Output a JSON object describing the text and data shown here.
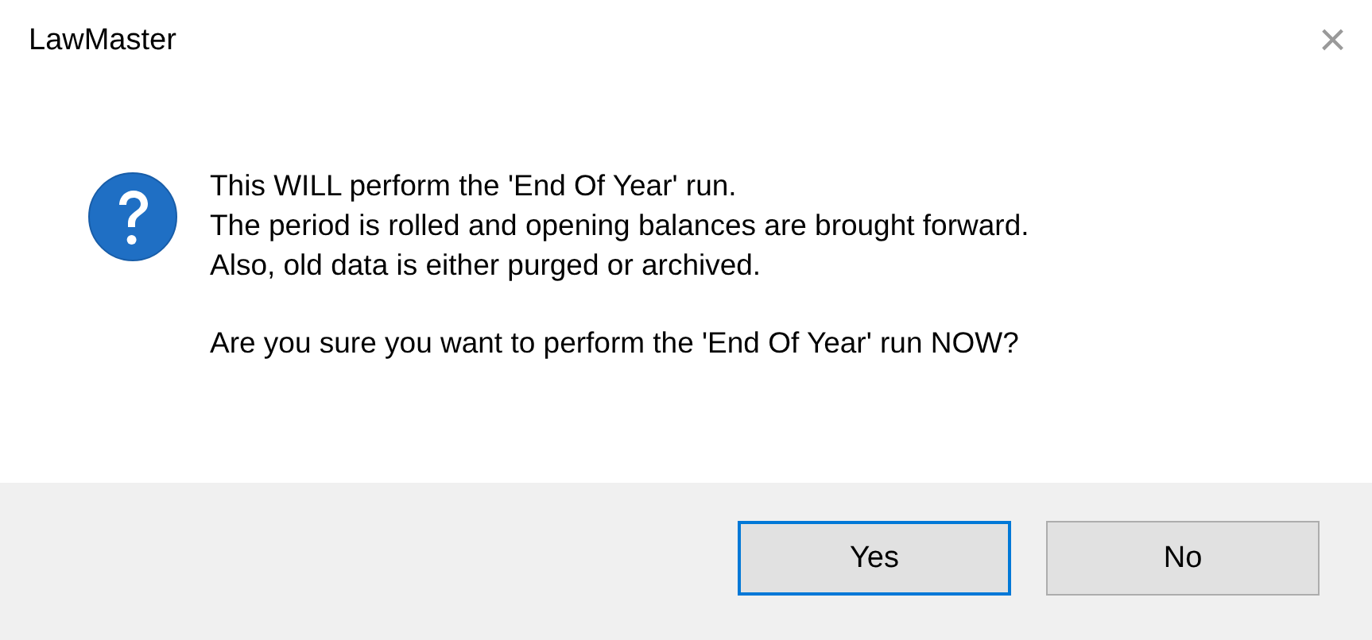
{
  "window": {
    "title": "LawMaster",
    "close": "×"
  },
  "message": {
    "lines": [
      "This WILL perform the 'End Of Year' run.",
      "The period is rolled and opening balances are brought forward.",
      "Also, old data is either purged or archived."
    ],
    "question": "Are you sure you want to perform the 'End Of Year' run NOW?"
  },
  "buttons": [
    {
      "label": "Yes",
      "default": true
    },
    {
      "label": "No",
      "default": false
    }
  ]
}
